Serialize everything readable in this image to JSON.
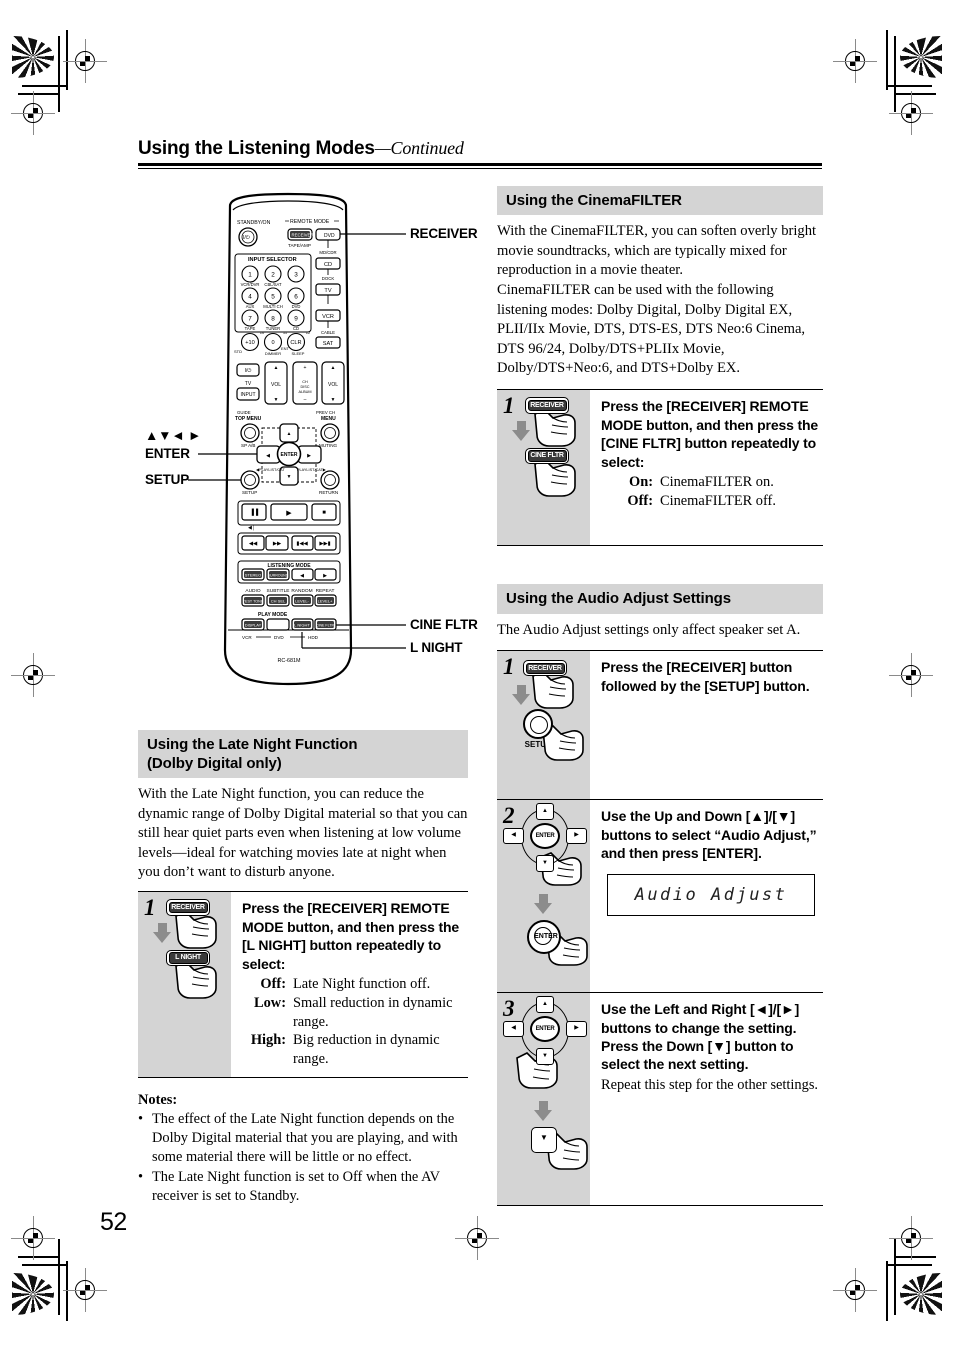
{
  "runhead": {
    "title": "Using the Listening Modes",
    "continued": "—Continued"
  },
  "page_number": "52",
  "remote": {
    "model": "RC-681M",
    "callouts": [
      {
        "name": "receiver",
        "label": "RECEIVER"
      },
      {
        "name": "arrows",
        "label": "▲▼◄ ►"
      },
      {
        "name": "enter",
        "label": "ENTER"
      },
      {
        "name": "setup",
        "label": "SETUP"
      },
      {
        "name": "cine-fltr",
        "label": "CINE FLTR"
      },
      {
        "name": "l-night",
        "label": "L NIGHT"
      }
    ],
    "labels": {
      "standby": "STANDBY/ON",
      "remote_mode": "REMOTE MODE",
      "input_selector": "INPUT SELECTOR",
      "listening_mode": "LISTENING MODE",
      "play_mode": "PLAY MODE",
      "tape_amp": "TAPE/AMP",
      "md_cdr": "MD/CDR",
      "dock": "DOCK",
      "cable": "CABLE",
      "top_menu": "TOP MENU",
      "guide": "GUIDE",
      "menu": "MENU",
      "prev_ch": "PREV CH",
      "return": "RETURN",
      "muting": "MUTING",
      "sp_ab": "SP A/B",
      "tv": "TV",
      "vol": "VOL",
      "input": "INPUT",
      "dimmer": "DIMMER",
      "sleep": "SLEEP",
      "ch": "CH",
      "disc": "DISC",
      "album": "ALBUM",
      "audio": "AUDIO",
      "subtitle": "SUBTITLE",
      "random": "RANDOM",
      "repeat": "REPEAT",
      "vcr": "VCR",
      "dvd": "DVD",
      "hdd": "HDD",
      "mode_keys": [
        "RECEIVER",
        "DVD",
        "CD",
        "TV",
        "VCR",
        "SAT"
      ],
      "numeric": [
        "1",
        "2",
        "3",
        "4",
        "5",
        "6",
        "7",
        "8",
        "9",
        "+10",
        "0",
        "CLR"
      ],
      "numeric_sub": [
        "VCR/DVR",
        "CBL/SAT",
        "",
        "AUX",
        "MULTI CH",
        "DVD",
        "TAPE",
        "TUNER",
        "CD"
      ],
      "listening_keys": [
        "STEREO",
        "SURROUND"
      ],
      "bottom_keys": [
        "DISPLAY",
        "L NIGHT",
        "CINE FLTR"
      ],
      "mid_keys": [
        "TEST TONE",
        "CH SEL",
        "LEVEL-",
        "LEVEL+"
      ]
    }
  },
  "left_column": {
    "late_night": {
      "heading_line1": "Using the Late Night Function",
      "heading_line2": "(Dolby Digital only)",
      "intro": "With the Late Night function, you can reduce the dynamic range of Dolby Digital material so that you can still hear quiet parts even when listening at low volume levels—ideal for watching movies late at night when you don’t want to disturb anyone.",
      "steps": [
        {
          "number": "1",
          "instruction": "Press the [RECEIVER] REMOTE MODE button, and then press the [L NIGHT] button repeatedly to select:",
          "buttons": [
            "RECEIVER",
            "L NIGHT"
          ],
          "options": [
            {
              "key": "Off:",
              "value": "Late Night function off."
            },
            {
              "key": "Low:",
              "value": "Small reduction in dynamic",
              "cont": "range."
            },
            {
              "key": "High:",
              "value": "Big reduction in dynamic",
              "cont": "range."
            }
          ]
        }
      ]
    },
    "notes": {
      "title": "Notes:",
      "items": [
        "The effect of the Late Night function depends on the Dolby Digital material that you are playing, and with some material there will be little or no effect.",
        "The Late Night function is set to Off when the AV receiver is set to Standby."
      ],
      "bullet": "•"
    }
  },
  "right_column": {
    "cinemafilter": {
      "heading": "Using the CinemaFILTER",
      "paragraphs": [
        "With the CinemaFILTER, you can soften overly bright movie soundtracks, which are typically mixed for reproduction in a movie theater.",
        "CinemaFILTER can be used with the following listening modes: Dolby Digital, Dolby Digital EX, PLII/IIx Movie, DTS, DTS-ES, DTS Neo:6 Cinema, DTS 96/24, Dolby/DTS+PLIIx Movie, Dolby/DTS+Neo:6, and DTS+Dolby EX."
      ],
      "steps": [
        {
          "number": "1",
          "instruction": "Press the [RECEIVER] REMOTE MODE button, and then press the [CINE FLTR] button repeatedly to select:",
          "buttons": [
            "RECEIVER",
            "CINE FLTR"
          ],
          "options": [
            {
              "key": "On:",
              "value": "CinemaFILTER on."
            },
            {
              "key": "Off:",
              "value": "CinemaFILTER off."
            }
          ]
        }
      ]
    },
    "audio_adjust": {
      "heading": "Using the Audio Adjust Settings",
      "intro": "The Audio Adjust settings only affect speaker set A.",
      "steps": [
        {
          "number": "1",
          "instruction": "Press the [RECEIVER] button followed by the [SETUP] button.",
          "buttons": [
            "RECEIVER",
            "SETUP"
          ]
        },
        {
          "number": "2",
          "instruction": "Use the Up and Down [▲]/[▼] buttons to select “Audio Adjust,” and then press [ENTER].",
          "lcd": "Audio Adjust",
          "enter_label": "ENTER"
        },
        {
          "number": "3",
          "instruction_line1": "Use the Left and Right [◄]/[►] buttons to change the setting.",
          "instruction_line2": "Press the Down [▼] button to select the next setting.",
          "sub": "Repeat this step for the other settings.",
          "enter_label": "ENTER"
        }
      ]
    }
  },
  "colors": {
    "gutter_gray": "#d4d4d4",
    "arrow_gray": "#8c8c8c",
    "rule_black": "#000000"
  }
}
